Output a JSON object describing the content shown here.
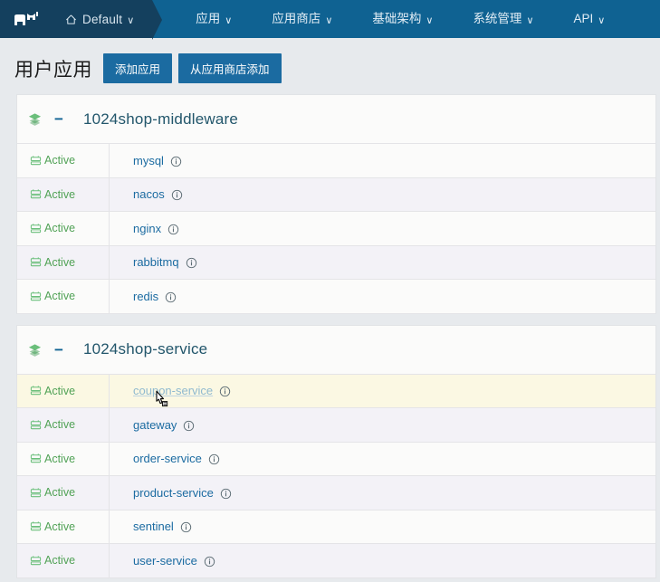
{
  "navbar": {
    "logo_icon": "rancher-cow-logo",
    "cluster": {
      "label": "Default",
      "icon": "home-icon",
      "caret": "∨"
    },
    "items": [
      {
        "label": "应用",
        "caret": "∨",
        "active": true
      },
      {
        "label": "应用商店",
        "caret": "∨",
        "active": false
      },
      {
        "label": "基础架构",
        "caret": "∨",
        "active": false
      },
      {
        "label": "系统管理",
        "caret": "∨",
        "active": false
      },
      {
        "label": "API",
        "caret": "∨",
        "active": false
      }
    ],
    "colors": {
      "bar": "#0f6292",
      "cluster_bg": "#14405e"
    }
  },
  "header": {
    "title": "用户应用",
    "buttons": [
      {
        "label": "添加应用"
      },
      {
        "label": "从应用商店添加"
      }
    ]
  },
  "table": {
    "status_label": "Active",
    "groups": [
      {
        "name": "1024shop-middleware",
        "collapse_glyph": "−",
        "stack_icon": "layers-icon",
        "rows": [
          {
            "status": "Active",
            "name": "mysql"
          },
          {
            "status": "Active",
            "name": "nacos"
          },
          {
            "status": "Active",
            "name": "nginx"
          },
          {
            "status": "Active",
            "name": "rabbitmq"
          },
          {
            "status": "Active",
            "name": "redis"
          }
        ]
      },
      {
        "name": "1024shop-service",
        "collapse_glyph": "−",
        "stack_icon": "layers-icon",
        "rows": [
          {
            "status": "Active",
            "name": "coupon-service",
            "hovered": true
          },
          {
            "status": "Active",
            "name": "gateway"
          },
          {
            "status": "Active",
            "name": "order-service"
          },
          {
            "status": "Active",
            "name": "product-service"
          },
          {
            "status": "Active",
            "name": "sentinel"
          },
          {
            "status": "Active",
            "name": "user-service"
          }
        ]
      }
    ]
  },
  "colors": {
    "accent": "#1b6ba1",
    "active_green": "#51a256",
    "link": "#1b6ba1",
    "page_bg": "#e7eaed",
    "row_bg": "#fbfbfa",
    "row_alt_bg": "#f3f2f7",
    "row_hover_bg": "#fbf8e3"
  }
}
